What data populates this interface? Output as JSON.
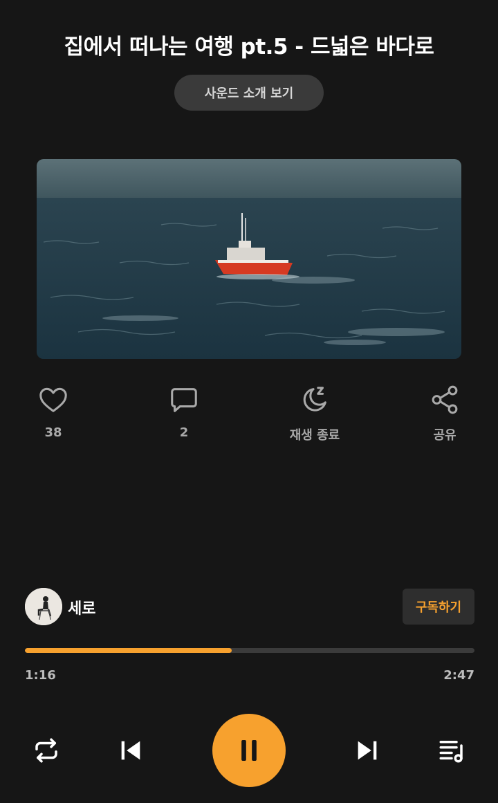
{
  "track": {
    "title": "집에서 떠나는 여행 pt.5 - 드넓은 바다로",
    "intro_button": "사운드 소개 보기"
  },
  "artwork": {
    "description_icon": "sea-boat-image"
  },
  "actions": [
    {
      "icon": "heart-icon",
      "label": "38"
    },
    {
      "icon": "comment-icon",
      "label": "2"
    },
    {
      "icon": "moon-sleep-icon",
      "label": "재생 종료"
    },
    {
      "icon": "share-icon",
      "label": "공유"
    }
  ],
  "artist": {
    "name": "세로",
    "subscribe_label": "구독하기"
  },
  "player": {
    "current_time": "1:16",
    "total_time": "2:47",
    "progress": 0.46,
    "state": "playing"
  },
  "colors": {
    "background": "#161616",
    "accent": "#f7a12e"
  }
}
